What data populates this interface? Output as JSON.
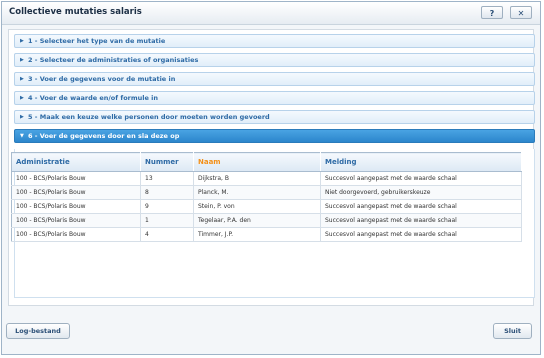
{
  "window": {
    "title": "Collectieve mutaties salaris",
    "help_label": "?",
    "close_label": "✕"
  },
  "steps": [
    {
      "label": "1 - Selecteer het type van de mutatie",
      "active": false
    },
    {
      "label": "2 - Selecteer de administraties of organisaties",
      "active": false
    },
    {
      "label": "3 - Voer de gegevens voor de mutatie in",
      "active": false
    },
    {
      "label": "4 - Voer de waarde en/of formule in",
      "active": false
    },
    {
      "label": "5 - Maak een keuze welke personen door moeten worden gevoerd",
      "active": false
    },
    {
      "label": "6 - Voer de gegevens door en sla deze op",
      "active": true
    }
  ],
  "table": {
    "columns": [
      "Administratie",
      "Nummer",
      "Naam",
      "Melding"
    ],
    "sorted_column": "Naam",
    "rows": [
      [
        "100 - BCS/Polaris Bouw",
        "13",
        "Dijkstra, B",
        "Succesvol aangepast met de waarde schaal"
      ],
      [
        "100 - BCS/Polaris Bouw",
        "8",
        "Planck, M.",
        "Niet doorgevoerd, gebruikerskeuze"
      ],
      [
        "100 - BCS/Polaris Bouw",
        "9",
        "Stein, P. von",
        "Succesvol aangepast met de waarde schaal"
      ],
      [
        "100 - BCS/Polaris Bouw",
        "1",
        "Tegelaar, P.A. den",
        "Succesvol aangepast met de waarde schaal"
      ],
      [
        "100 - BCS/Polaris Bouw",
        "4",
        "Timmer, J.P.",
        "Succesvol aangepast met de waarde schaal"
      ]
    ]
  },
  "footer": {
    "log_label": "Log-bestand",
    "close_label": "Sluit"
  },
  "colors": {
    "accent": "#2e6aa5",
    "active_step": "#3a95d8",
    "sorted_header": "#f39019"
  }
}
